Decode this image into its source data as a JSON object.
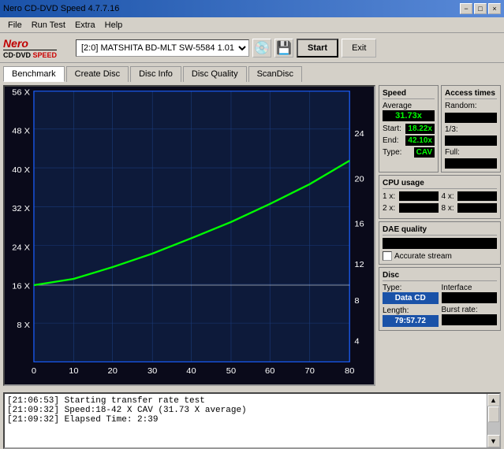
{
  "titlebar": {
    "title": "Nero CD-DVD Speed 4.7.7.16",
    "buttons": [
      "−",
      "□",
      "×"
    ]
  },
  "menubar": {
    "items": [
      "File",
      "Run Test",
      "Extra",
      "Help"
    ]
  },
  "toolbar": {
    "logo_line1": "Nero",
    "logo_line2": "CD·DVD SPEED",
    "drive": "[2:0]  MATSHITA BD-MLT SW-5584 1.01",
    "start_label": "Start",
    "exit_label": "Exit"
  },
  "tabs": {
    "items": [
      "Benchmark",
      "Create Disc",
      "Disc Info",
      "Disc Quality",
      "ScanDisc"
    ],
    "active": "Benchmark"
  },
  "chart": {
    "y_labels_left": [
      "56 X",
      "48 X",
      "40 X",
      "32 X",
      "24 X",
      "16 X",
      "8 X",
      "0"
    ],
    "y_labels_right": [
      "24",
      "20",
      "16",
      "12",
      "8",
      "4"
    ],
    "x_labels": [
      "0",
      "10",
      "20",
      "30",
      "40",
      "50",
      "60",
      "70",
      "80"
    ]
  },
  "speed": {
    "header": "Speed",
    "average_label": "Average",
    "average_value": "31.73x",
    "start_label": "Start:",
    "start_value": "18.22x",
    "end_label": "End:",
    "end_value": "42.10x",
    "type_label": "Type:",
    "type_value": "CAV"
  },
  "access_times": {
    "header": "Access times",
    "random_label": "Random:",
    "one_third_label": "1/3:",
    "full_label": "Full:"
  },
  "cpu_usage": {
    "header": "CPU usage",
    "labels": [
      "1 x:",
      "2 x:",
      "4 x:",
      "8 x:"
    ]
  },
  "dae": {
    "header": "DAE quality",
    "accurate_label": "Accurate stream"
  },
  "disc": {
    "header": "Disc",
    "type_label": "Type:",
    "type_value": "Data CD",
    "length_label": "Length:",
    "length_value": "79:57.72",
    "burst_label": "Burst rate:"
  },
  "log": {
    "lines": [
      "[21:06:53]  Starting transfer rate test",
      "[21:09:32]  Speed:18-42 X CAV (31.73 X average)",
      "[21:09:32]  Elapsed Time: 2:39"
    ]
  }
}
